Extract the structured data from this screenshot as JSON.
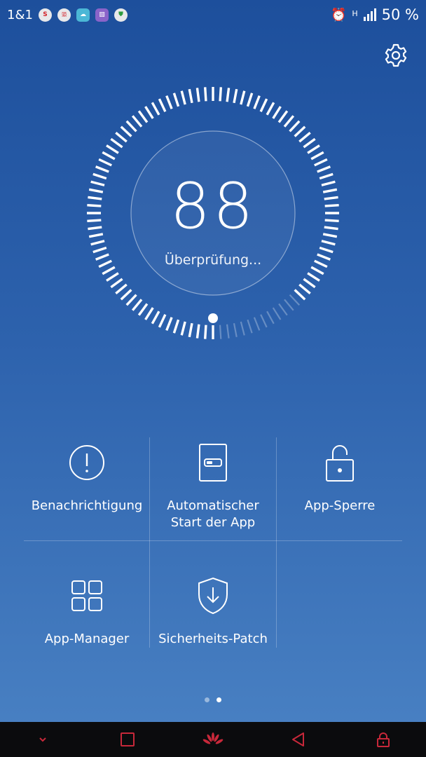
{
  "status_bar": {
    "carrier": "1&1",
    "network_type": "H",
    "battery": "50 %",
    "icons": [
      "shopping-icon",
      "news-icon",
      "weather-icon",
      "gallery-icon",
      "shield-icon"
    ]
  },
  "header": {
    "settings_icon": "gear-icon"
  },
  "scan": {
    "score": "88",
    "status": "Überprüfung...",
    "progress": 0.88
  },
  "tools": [
    {
      "label": "Benachrichtigung",
      "icon": "alert-icon"
    },
    {
      "label": "Automatischer Start der App",
      "icon": "autostart-icon"
    },
    {
      "label": "App-Sperre",
      "icon": "lock-icon"
    },
    {
      "label": "App-Manager",
      "icon": "grid-icon"
    },
    {
      "label": "Sicherheits-Patch",
      "icon": "shield-download-icon"
    }
  ],
  "pager": {
    "pages": 2,
    "active": 2
  },
  "nav": [
    "collapse-icon",
    "recents-icon",
    "home-logo-icon",
    "back-icon",
    "lock-icon"
  ],
  "colors": {
    "accent": "#ffffff",
    "navbar": "#0b0b0d"
  }
}
